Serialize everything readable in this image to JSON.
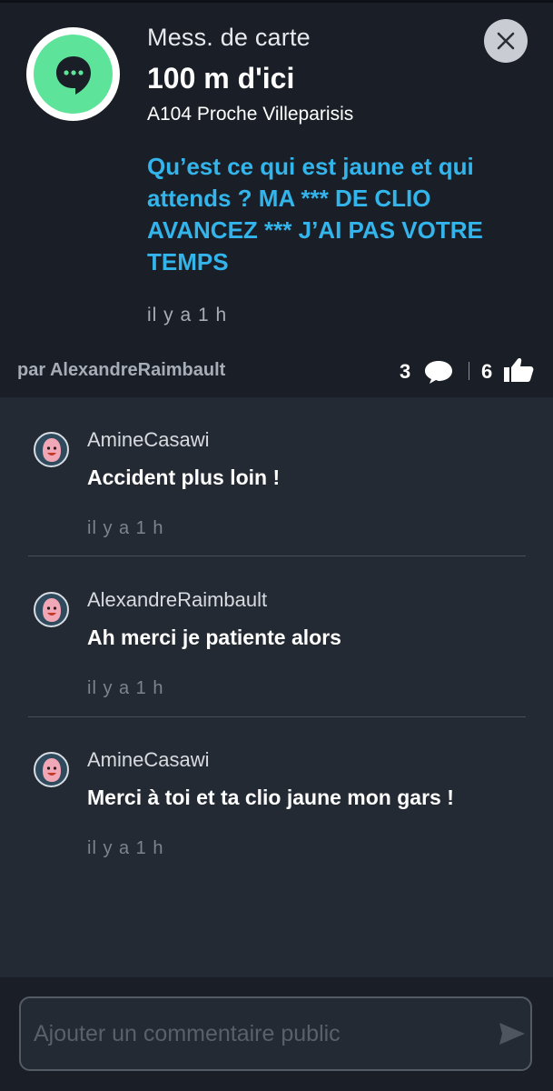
{
  "header": {
    "title": "Mess. de carte",
    "distance": "100 m d'ici",
    "location": "A104 Proche Villeparisis",
    "message": "Qu’est ce qui est jaune et qui attends ? MA *** DE CLIO AVANCEZ *** J’AI PAS VOTRE TEMPS",
    "time": "il y a 1 h",
    "author": "par AlexandreRaimbault",
    "comments_count": "3",
    "likes_count": "6",
    "icon": "chat-bubble-icon"
  },
  "comments": [
    {
      "user": "AmineCasawi",
      "text": "Accident plus loin !",
      "time": "il y a 1 h"
    },
    {
      "user": "AlexandreRaimbault",
      "text": "Ah merci je patiente alors",
      "time": "il y a 1 h"
    },
    {
      "user": "AmineCasawi",
      "text": "Merci à toi et ta clio jaune mon gars !",
      "time": "il y a 1 h"
    }
  ],
  "composer": {
    "placeholder": "Ajouter un commentaire public",
    "value": ""
  },
  "colors": {
    "accent": "#33b5ec",
    "avatar_green": "#5ee39a",
    "header_bg": "#1a1f27",
    "body_bg": "#242a33"
  }
}
